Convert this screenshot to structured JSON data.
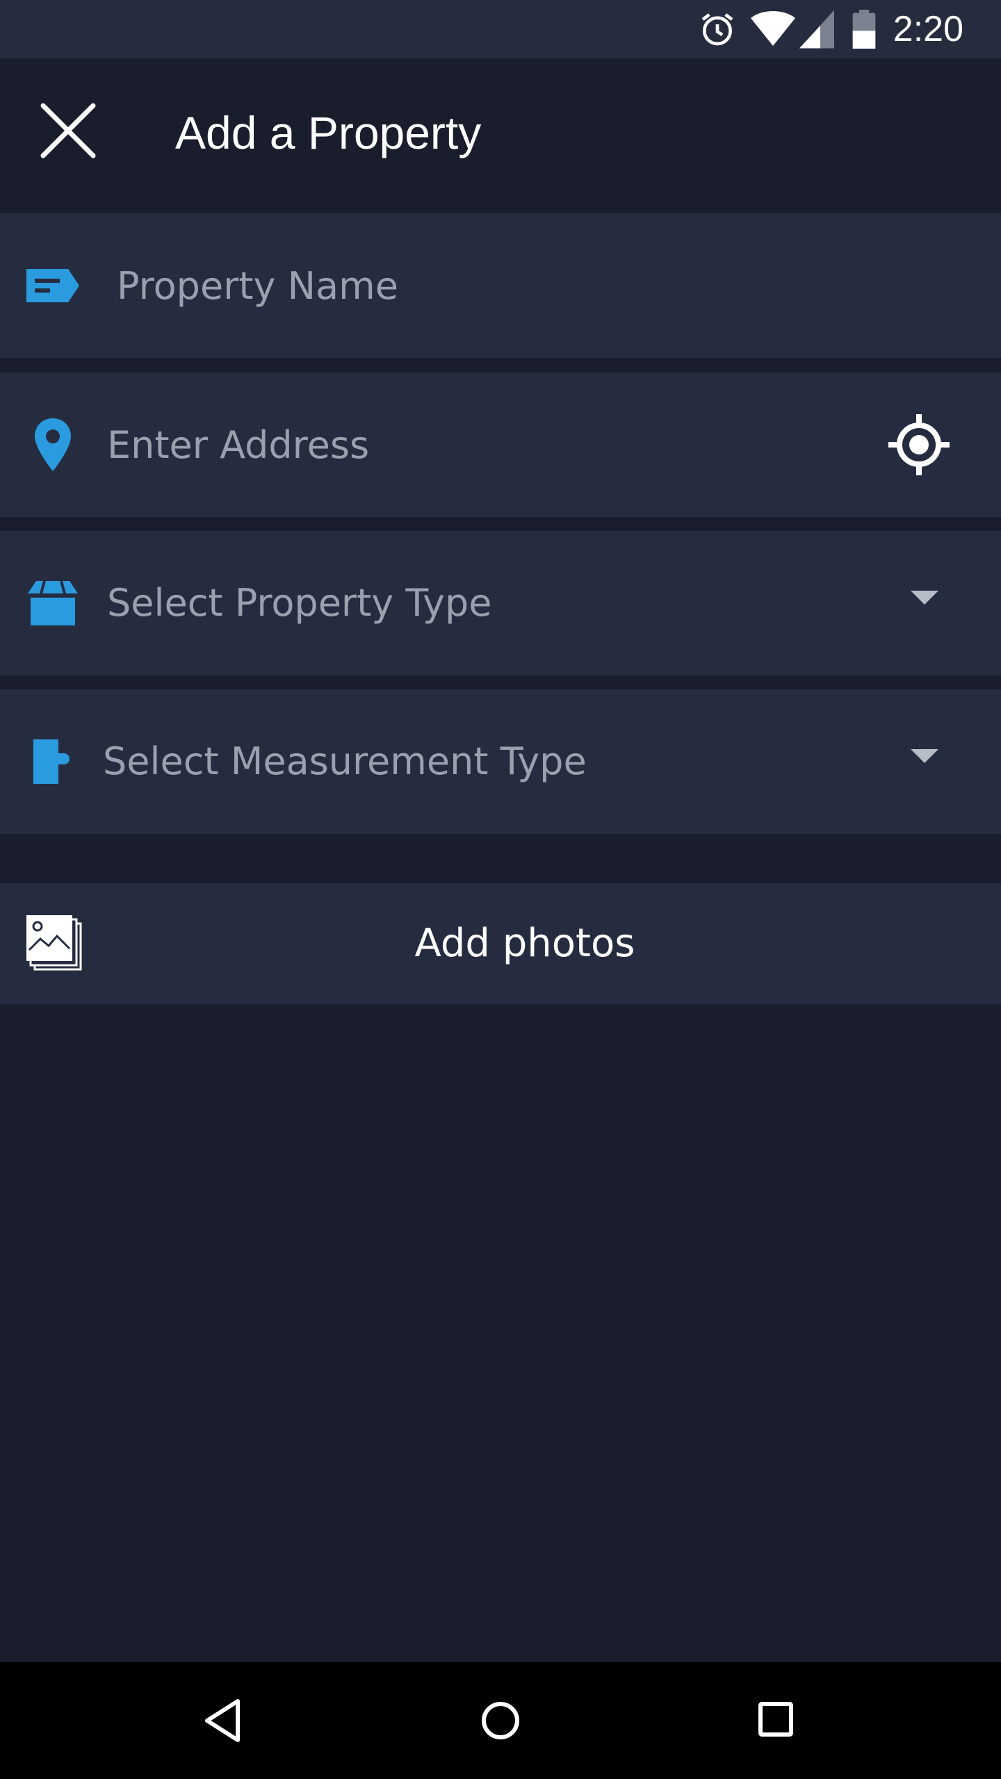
{
  "status_bar": {
    "time": "2:20",
    "icons": [
      "alarm-icon",
      "wifi-icon",
      "signal-icon",
      "battery-icon"
    ]
  },
  "app_bar": {
    "title": "Add a Property",
    "close_icon": "close-icon"
  },
  "form": {
    "property_name": {
      "placeholder": "Property Name",
      "value": "",
      "icon": "tag-icon"
    },
    "address": {
      "placeholder": "Enter Address",
      "value": "",
      "icon": "location-pin-icon",
      "action_icon": "my-location-icon"
    },
    "property_type": {
      "label": "Select Property Type",
      "icon": "box-icon"
    },
    "measurement_type": {
      "label": "Select Measurement Type",
      "icon": "puzzle-icon"
    }
  },
  "photos": {
    "label": "Add photos",
    "icon": "photos-icon"
  },
  "nav_bar": {
    "items": [
      "back-icon",
      "home-icon",
      "recents-icon"
    ]
  },
  "colors": {
    "accent": "#2b9be0",
    "background": "#1a1e2c",
    "row_background": "#262c3f",
    "placeholder": "#9aa0ad"
  }
}
